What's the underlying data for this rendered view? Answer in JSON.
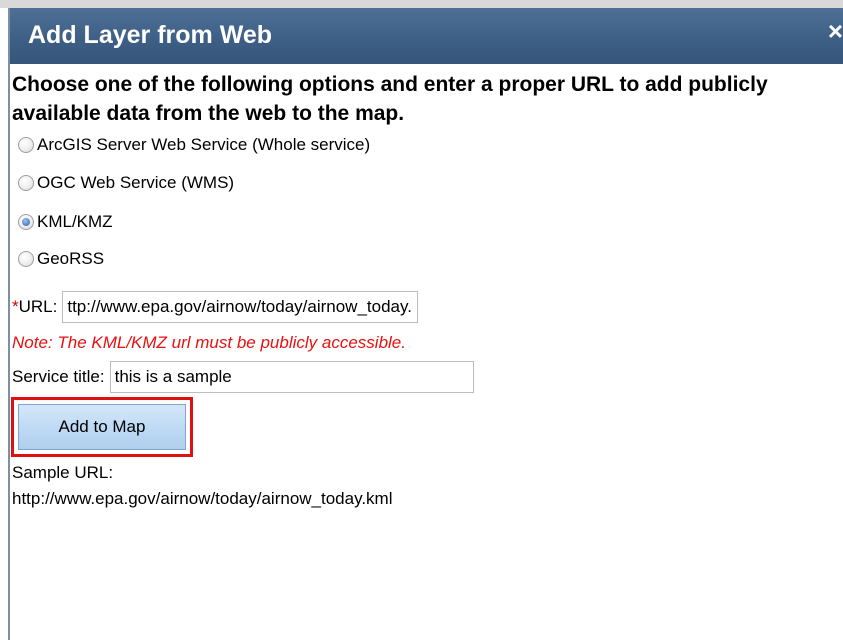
{
  "dialog": {
    "title": "Add Layer from Web",
    "close_glyph": "×"
  },
  "instructions": "Choose one of the following options and enter a proper URL to add publicly available data from the web to the map.",
  "service_types": {
    "selected": "KML/KMZ",
    "options": [
      {
        "label": "ArcGIS Server Web Service (Whole service)",
        "checked": false
      },
      {
        "label": "OGC Web Service (WMS)",
        "checked": false
      },
      {
        "label": "KML/KMZ",
        "checked": true
      },
      {
        "label": "GeoRSS",
        "checked": false
      }
    ]
  },
  "url_field": {
    "required_mark": "*",
    "label": "URL:",
    "value": "ttp://www.epa.gov/airnow/today/airnow_today.kml"
  },
  "note": "Note: The KML/KMZ url must be publicly accessible.",
  "title_field": {
    "label": "Service title:",
    "value": "this is a sample"
  },
  "add_button": {
    "label": "Add to Map"
  },
  "sample": {
    "label": "Sample URL:",
    "url": "http://www.epa.gov/airnow/today/airnow_today.kml"
  },
  "colors": {
    "titlebar": "#3e5f86",
    "note_text": "#e81010",
    "highlight_border": "#e01010",
    "button_fill": "#bcd8f4"
  },
  "icons": {
    "close": "close-icon",
    "radio": "radio-button"
  }
}
